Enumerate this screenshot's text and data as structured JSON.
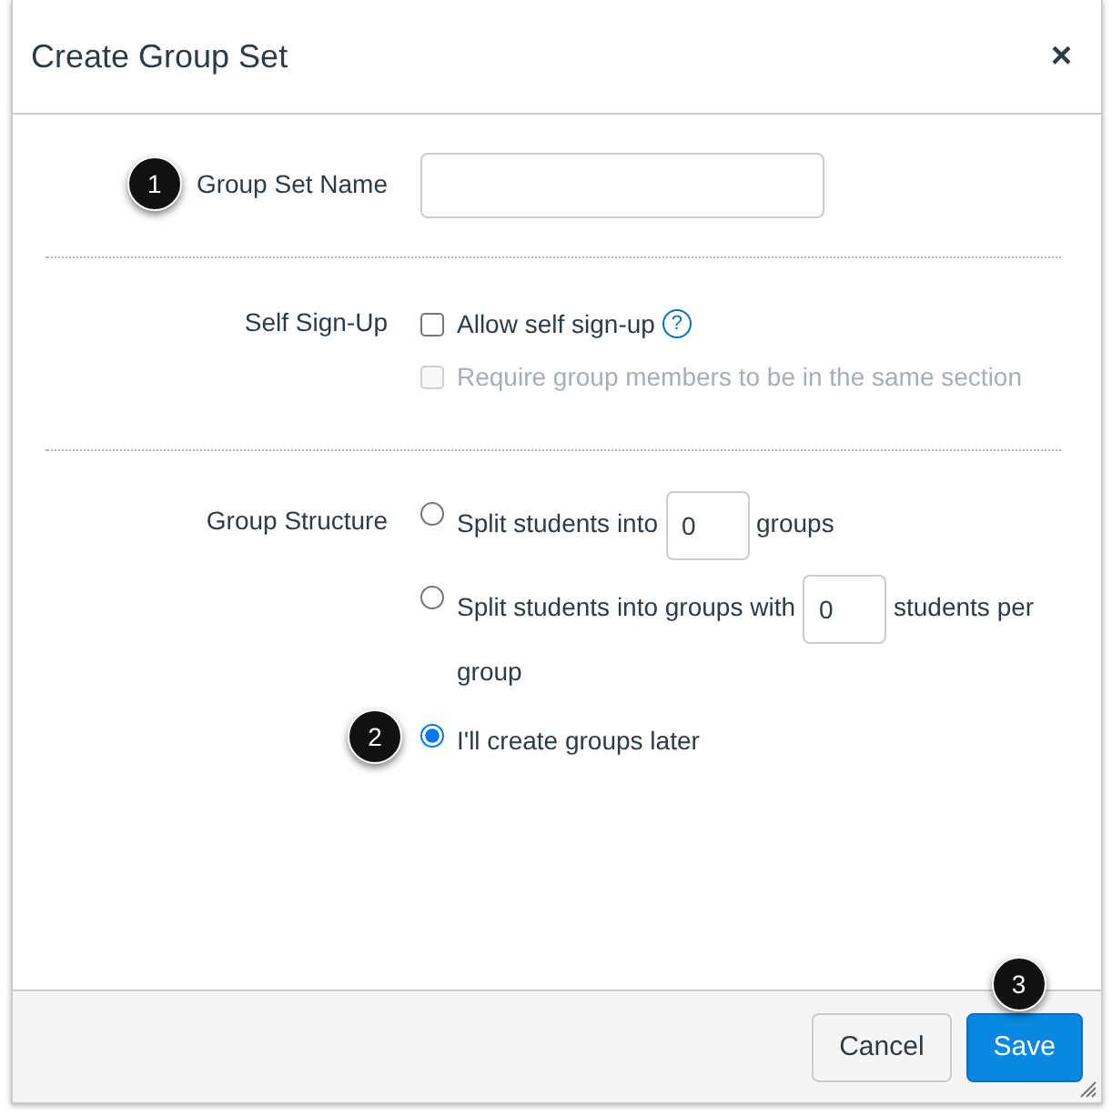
{
  "dialog": {
    "title": "Create Group Set",
    "close": "×"
  },
  "name_row": {
    "label": "Group Set Name",
    "callout": "1"
  },
  "self_signup": {
    "label": "Self Sign-Up",
    "options": [
      {
        "label": "Allow self sign-up",
        "checked": false,
        "disabled": false,
        "help": "?"
      },
      {
        "label": "Require group members to be in the same section",
        "checked": false,
        "disabled": true
      }
    ]
  },
  "group_structure": {
    "label": "Group Structure",
    "options": [
      {
        "kind": "count",
        "before": "Split students into",
        "count": "0",
        "after": "groups",
        "selected": false
      },
      {
        "kind": "count",
        "before": "Split students into groups with",
        "count": "0",
        "after": "students per",
        "continuation": "group",
        "selected": false
      },
      {
        "kind": "plain",
        "label": "I'll create groups later",
        "selected": true,
        "callout": "2"
      }
    ]
  },
  "footer": {
    "buttons": [
      {
        "label": "Cancel",
        "kind": "secondary"
      },
      {
        "label": "Save",
        "kind": "primary",
        "callout": "3"
      }
    ]
  }
}
